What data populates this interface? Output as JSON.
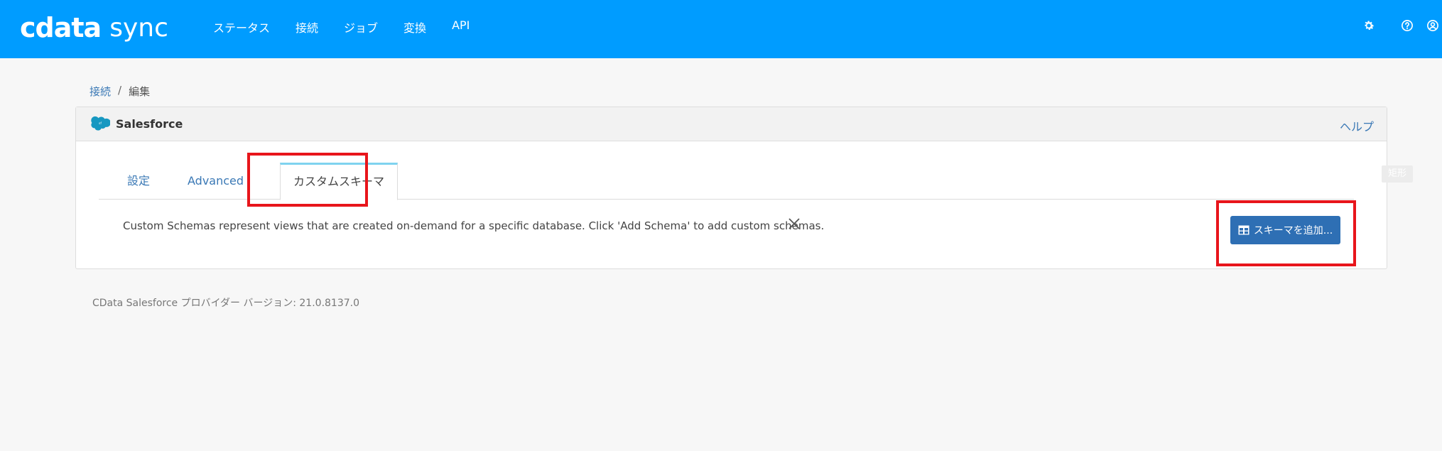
{
  "header": {
    "brand_main": "cdata",
    "brand_sub": "sync",
    "nav": [
      "ステータス",
      "接続",
      "ジョブ",
      "変換",
      "API"
    ],
    "icons": [
      "gear-icon",
      "help-icon",
      "user-icon"
    ],
    "bg_color": "#009cff"
  },
  "breadcrumb": {
    "link": "接続",
    "separator": "/",
    "current": "編集"
  },
  "card": {
    "title": "Salesforce",
    "help": "ヘルプ",
    "tabs": [
      "設定",
      "Advanced",
      "カスタムスキーマ"
    ],
    "active_tab": "カスタムスキーマ",
    "info": "Custom Schemas represent views that are created on-demand for a specific database. Click 'Add Schema' to add custom schemas.",
    "add_button": "スキーマを追加..."
  },
  "ghost_label": "矩形",
  "footer_version": "CData Salesforce プロバイダー バージョン: 21.0.8137.0",
  "colors": {
    "accent": "#2e6fb4",
    "link": "#3a78b5",
    "highlight": "#e8151b"
  }
}
